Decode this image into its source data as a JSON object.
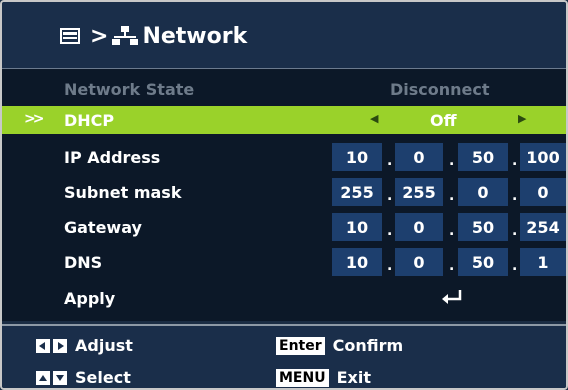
{
  "header": {
    "separator": ">",
    "title": "Network"
  },
  "rows": {
    "network_state": {
      "label": "Network State",
      "value": "Disconnect"
    },
    "dhcp": {
      "label": "DHCP",
      "value": "Off"
    },
    "ip_address": {
      "label": "IP Address",
      "octets": [
        "10",
        "0",
        "50",
        "100"
      ]
    },
    "subnet_mask": {
      "label": "Subnet mask",
      "octets": [
        "255",
        "255",
        "0",
        "0"
      ]
    },
    "gateway": {
      "label": "Gateway",
      "octets": [
        "10",
        "0",
        "50",
        "254"
      ]
    },
    "dns": {
      "label": "DNS",
      "octets": [
        "10",
        "0",
        "50",
        "1"
      ]
    },
    "apply": {
      "label": "Apply"
    }
  },
  "footer": {
    "adjust": "Adjust",
    "select": "Select",
    "enter_key": "Enter",
    "confirm": "Confirm",
    "menu_key": "MENU",
    "exit": "Exit"
  },
  "colors": {
    "highlight": "#9ad22a",
    "field": "#1d3f6e",
    "panel": "#1a2e4a"
  }
}
